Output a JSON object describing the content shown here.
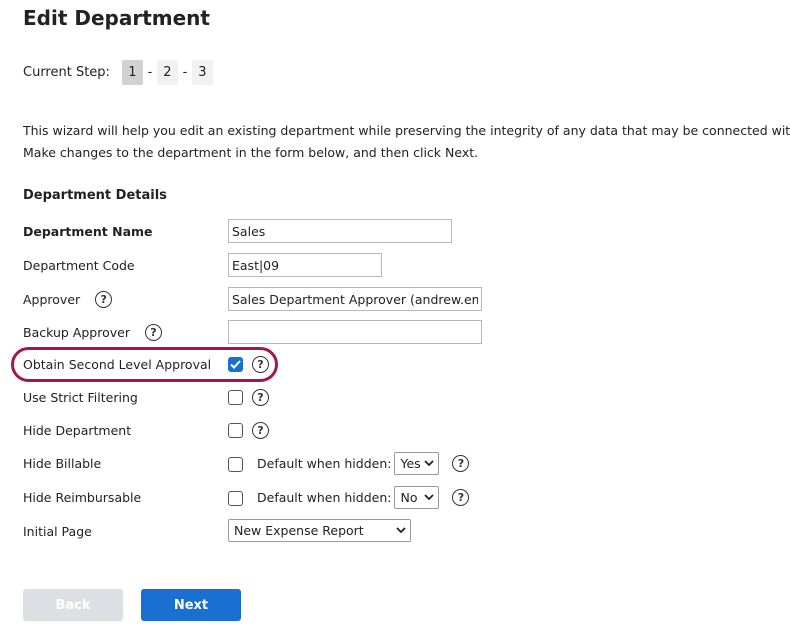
{
  "page": {
    "title": "Edit Department"
  },
  "steps": {
    "label": "Current Step:",
    "items": [
      "1",
      "2",
      "3"
    ],
    "separator": "-",
    "active_index": 0
  },
  "intro": {
    "line1": "This wizard will help you edit an existing department while preserving the integrity of any data that may be connected with it.",
    "line2": "Make changes to the department in the form below, and then click Next."
  },
  "section": {
    "title": "Department Details"
  },
  "help_glyph": "?",
  "fields": {
    "department_name": {
      "label": "Department Name",
      "value": "Sales"
    },
    "department_code": {
      "label": "Department Code",
      "value": "East|09"
    },
    "approver": {
      "label": "Approver",
      "value": "Sales Department Approver (andrew.emp"
    },
    "backup_approver": {
      "label": "Backup Approver",
      "value": ""
    },
    "second_level_approval": {
      "label": "Obtain Second Level Approval",
      "checked": true
    },
    "strict_filtering": {
      "label": "Use Strict Filtering",
      "checked": false
    },
    "hide_department": {
      "label": "Hide Department",
      "checked": false
    },
    "hide_billable": {
      "label": "Hide Billable",
      "checked": false,
      "default_label": "Default when hidden:",
      "default_value": "Yes"
    },
    "hide_reimbursable": {
      "label": "Hide Reimbursable",
      "checked": false,
      "default_label": "Default when hidden:",
      "default_value": "No"
    },
    "initial_page": {
      "label": "Initial Page",
      "value": "New Expense Report"
    }
  },
  "buttons": {
    "back": "Back",
    "next": "Next"
  },
  "colors": {
    "accent": "#1a6fd1",
    "highlight": "#a3174f",
    "disabled_button": "#dcdfe3"
  }
}
